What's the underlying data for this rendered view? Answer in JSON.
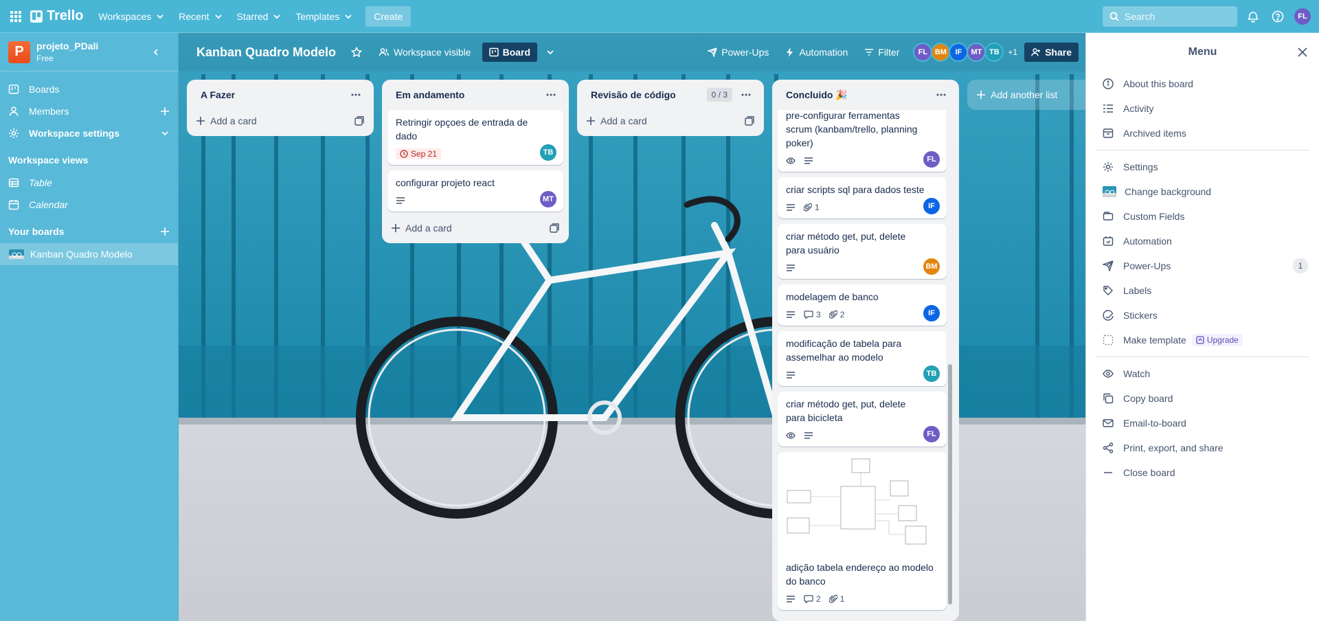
{
  "topbar": {
    "logo": "Trello",
    "nav": [
      "Workspaces",
      "Recent",
      "Starred",
      "Templates"
    ],
    "create": "Create",
    "search_placeholder": "Search",
    "user_initials": "FL"
  },
  "sidebar": {
    "workspace_name": "projeto_PDali",
    "workspace_plan": "Free",
    "workspace_badge": "P",
    "items": [
      {
        "label": "Boards"
      },
      {
        "label": "Members"
      },
      {
        "label": "Workspace settings"
      }
    ],
    "views_heading": "Workspace views",
    "views": [
      {
        "label": "Table"
      },
      {
        "label": "Calendar"
      }
    ],
    "boards_heading": "Your boards",
    "boards": [
      {
        "label": "Kanban Quadro Modelo"
      }
    ]
  },
  "board_header": {
    "title": "Kanban Quadro Modelo",
    "visibility": "Workspace visible",
    "view": "Board",
    "power_ups": "Power-Ups",
    "automation": "Automation",
    "filter": "Filter",
    "members": [
      {
        "initials": "FL",
        "color": "#6e5dc6"
      },
      {
        "initials": "BM",
        "color": "#e2850e"
      },
      {
        "initials": "IF",
        "color": "#0c66e4"
      },
      {
        "initials": "MT",
        "color": "#6e5dc6"
      },
      {
        "initials": "TB",
        "color": "#22a0b5"
      }
    ],
    "extra_members": "+1",
    "share": "Share"
  },
  "lists": [
    {
      "title": "A Fazer",
      "add_card": "Add a card"
    },
    {
      "title": "Em andamento",
      "add_card": "Add a card",
      "cards": [
        {
          "title": "Retringir opçoes de entrada de dado",
          "date": "Sep 21",
          "member": "TB",
          "member_color": "#22a0b5"
        },
        {
          "title": "configurar projeto react",
          "member": "MT",
          "member_color": "#6e5dc6"
        }
      ]
    },
    {
      "title": "Revisão de código",
      "count": "0 / 3",
      "add_card": "Add a card"
    },
    {
      "title": "Concluido 🎉",
      "cards": [
        {
          "title": "pre-configurar ferramentas scrum (kanbam/trello, planning poker)",
          "member": "FL",
          "member_color": "#6e5dc6"
        },
        {
          "title": "criar scripts sql para dados teste",
          "attachments": "1",
          "member": "IF",
          "member_color": "#0c66e4"
        },
        {
          "title": "criar método get, put, delete para usuário",
          "member": "BM",
          "member_color": "#e2850e"
        },
        {
          "title": "modelagem de banco",
          "comments": "3",
          "attachments": "2",
          "member": "IF",
          "member_color": "#0c66e4"
        },
        {
          "title": "modificação de tabela para assemelhar ao modelo",
          "member": "TB",
          "member_color": "#22a0b5"
        },
        {
          "title": "criar método get, put, delete para bicicleta",
          "member": "FL",
          "member_color": "#6e5dc6"
        },
        {
          "title": "adição tabela endereço ao modelo do banco",
          "comments": "2",
          "attachments": "1"
        }
      ]
    }
  ],
  "add_another_list": "Add another list",
  "menu": {
    "title": "Menu",
    "items_top": [
      "About this board",
      "Activity",
      "Archived items"
    ],
    "items_mid": [
      "Settings",
      "Change background",
      "Custom Fields",
      "Automation",
      "Power-Ups",
      "Labels",
      "Stickers",
      "Make template"
    ],
    "power_ups_count": "1",
    "upgrade": "Upgrade",
    "items_bottom": [
      "Watch",
      "Copy board",
      "Email-to-board",
      "Print, export, and share",
      "Close board"
    ]
  }
}
